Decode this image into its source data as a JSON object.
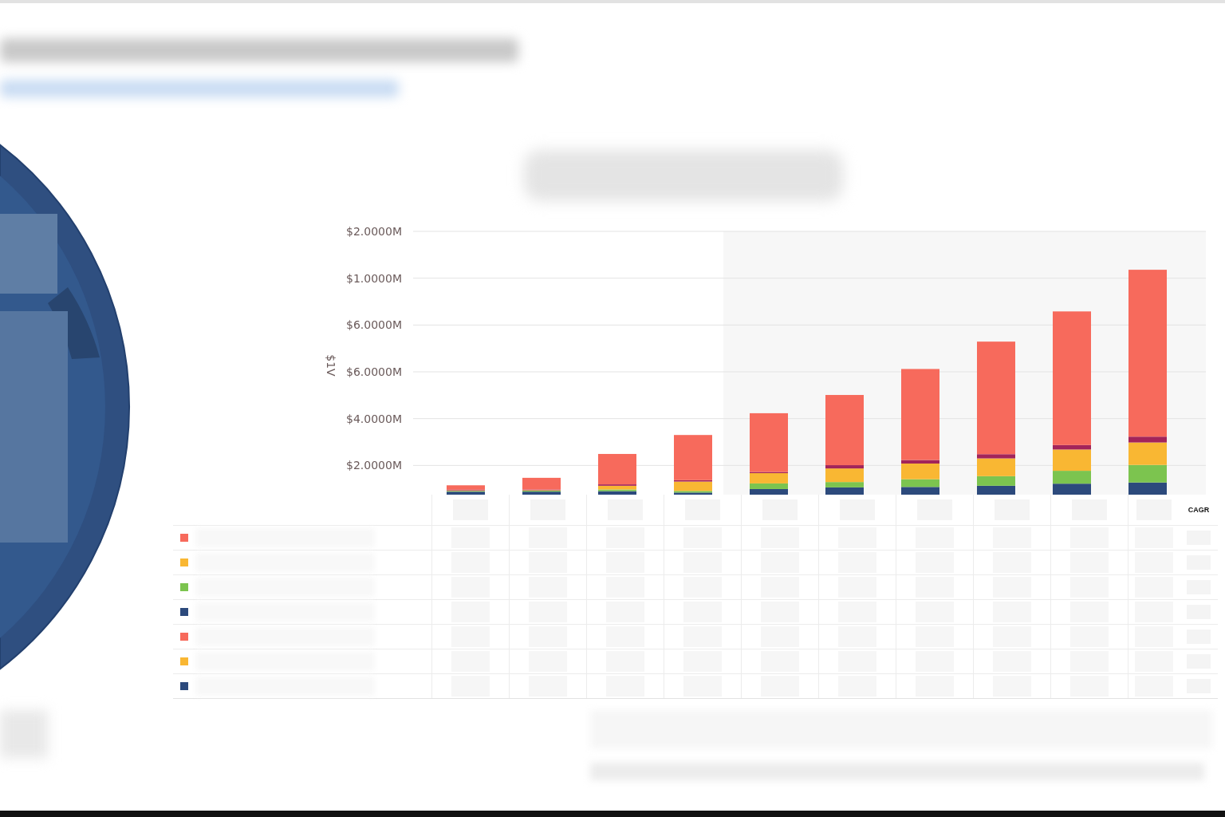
{
  "chart": {
    "ylabel": "$1V",
    "tick_labels": [
      "$2.0000M",
      "$1.0000M",
      "$6.0000M",
      "$6.0000M",
      "$4.0000M",
      "$2.0000M"
    ]
  },
  "table": {
    "cagr_header": "CAGR",
    "rows": [
      {
        "color": "#f76a5c"
      },
      {
        "color": "#f9b733"
      },
      {
        "color": "#7cc44f"
      },
      {
        "color": "#2c4a7c"
      },
      {
        "color": "#f76a5c"
      },
      {
        "color": "#f9b733"
      },
      {
        "color": "#2c4a7c"
      }
    ]
  }
}
